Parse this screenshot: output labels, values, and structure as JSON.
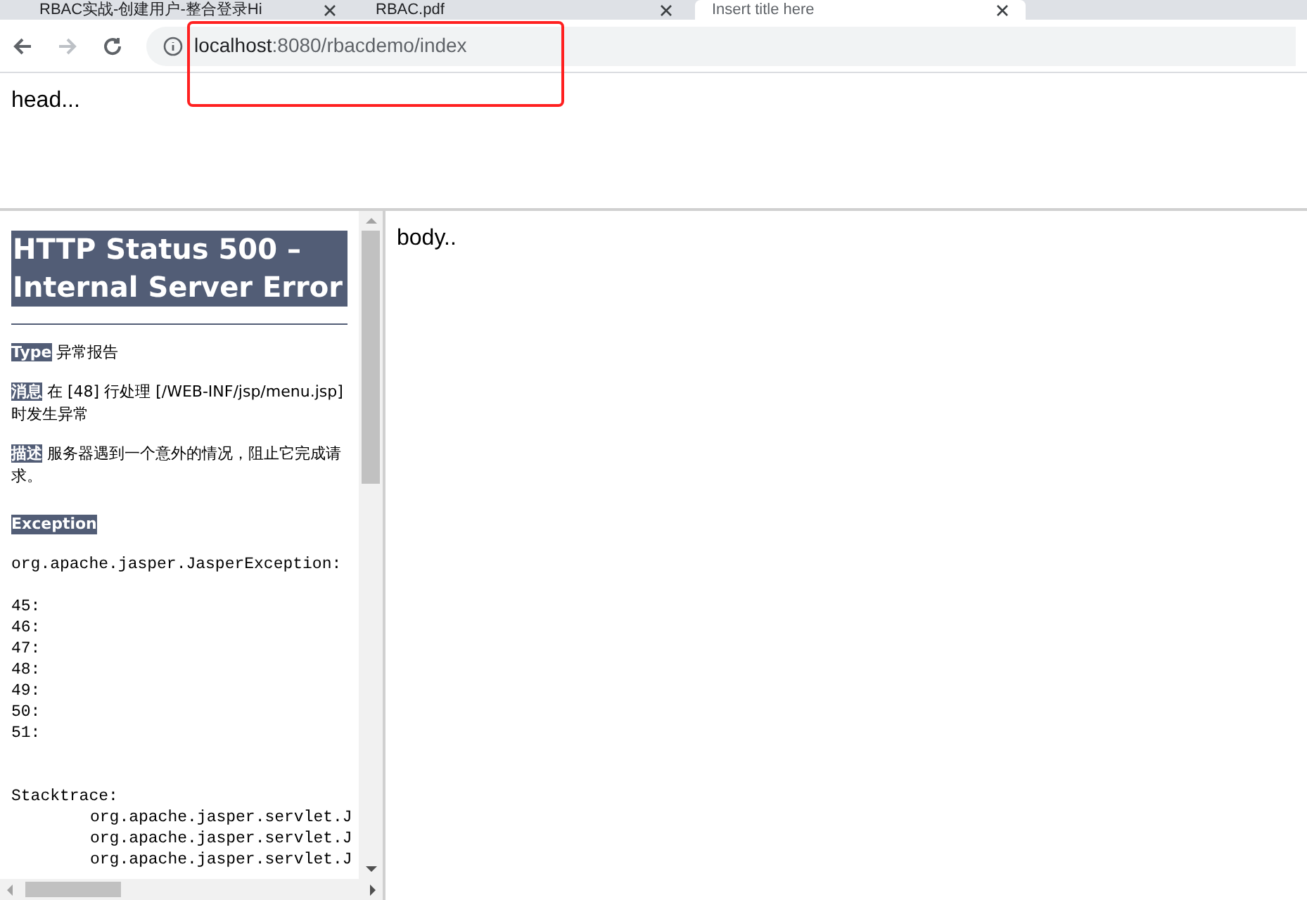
{
  "tabs": [
    {
      "title": "RBAC实战-创建用户-整合登录Hi",
      "selected": false
    },
    {
      "title": "RBAC.pdf",
      "selected": false
    },
    {
      "title": "Insert title here",
      "selected": true
    }
  ],
  "address_bar": {
    "host": "localhost",
    "path": ":8080/rbacdemo/index"
  },
  "head_frame": {
    "text": "head..."
  },
  "menu_frame": {
    "title_line_1": "HTTP Status 500 –",
    "title_line_2": "Internal Server Error",
    "fields": [
      {
        "label": "Type",
        "text": "异常报告"
      },
      {
        "label": "消息",
        "text": "在 [48] 行处理 [/WEB-INF/jsp/menu.jsp] 时发生异常"
      },
      {
        "label": "描述",
        "text": "服务器遇到一个意外的情况，阻止它完成请求。"
      }
    ],
    "exception_label": "Exception",
    "exception_text": "org.apache.jasper.JasperException:",
    "code_lines": [
      "45:",
      "46:",
      "47:",
      "48:",
      "49:",
      "50:",
      "51:"
    ],
    "stacktrace_label": "Stacktrace:",
    "stacktrace_lines": [
      "org.apache.jasper.servlet.J",
      "org.apache.jasper.servlet.J",
      "org.apache.jasper.servlet.J"
    ]
  },
  "body_frame": {
    "text": "body.."
  }
}
